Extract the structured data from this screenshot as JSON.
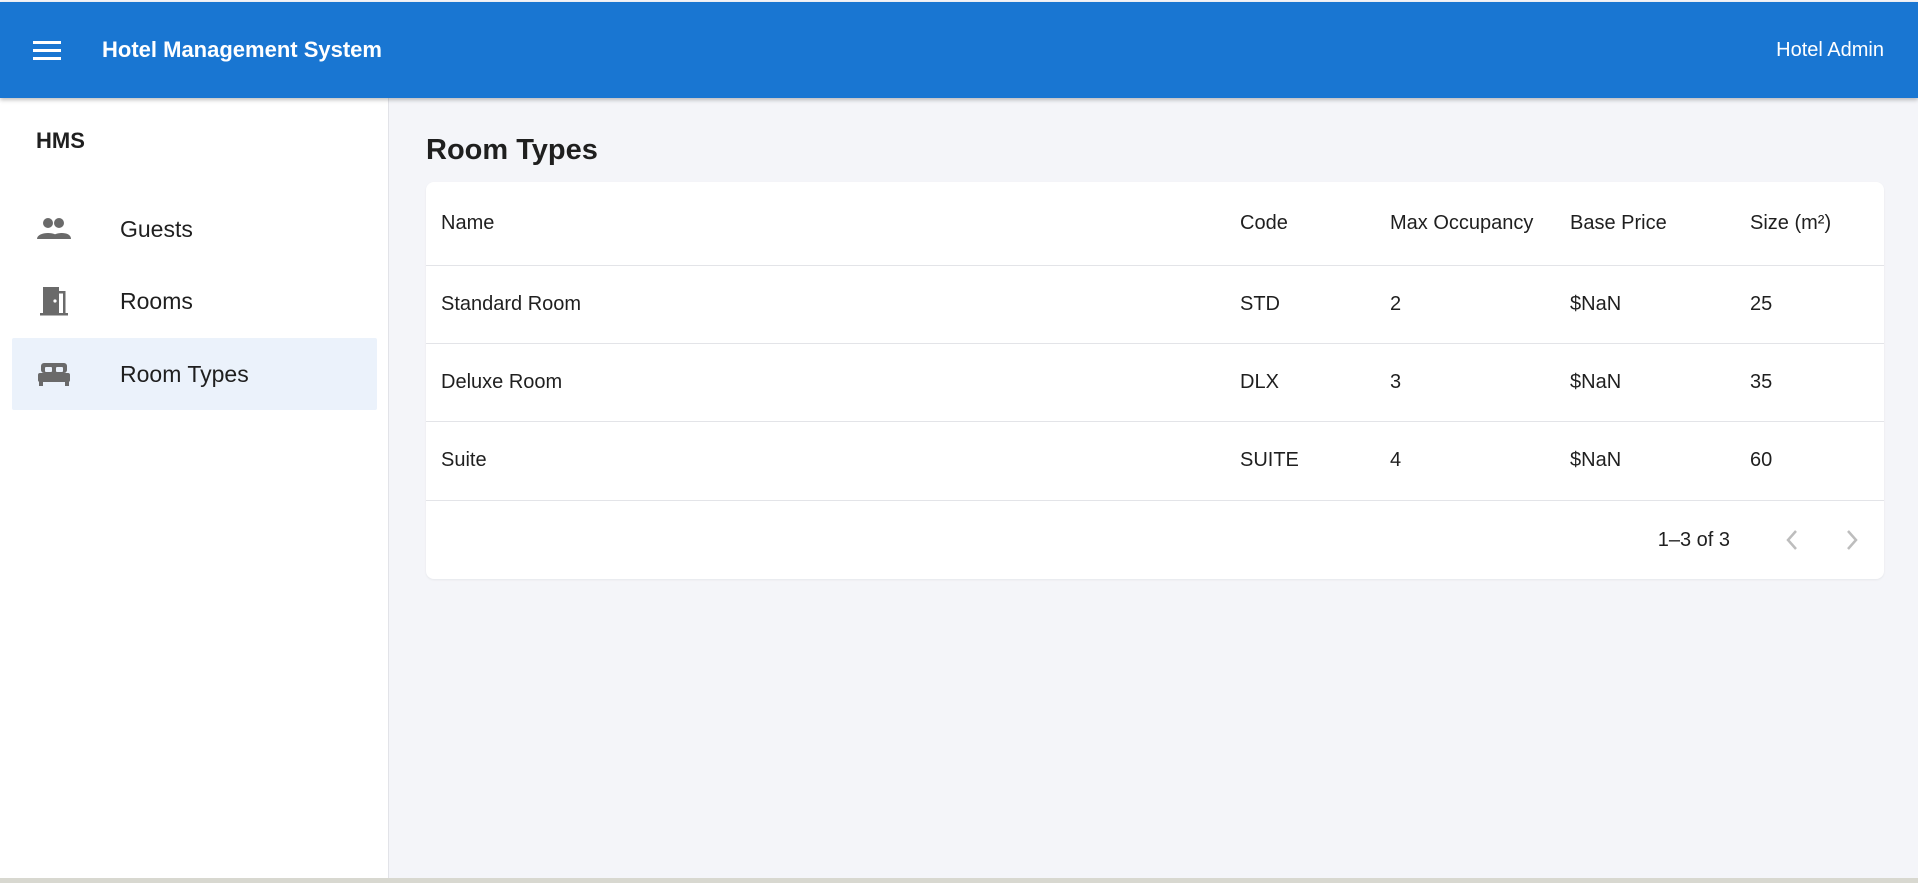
{
  "header": {
    "title": "Hotel Management System",
    "user": "Hotel Admin",
    "color": "#1976d2"
  },
  "sidebar": {
    "brand": "HMS",
    "items": [
      {
        "label": "Guests",
        "icon": "people-icon",
        "active": false
      },
      {
        "label": "Rooms",
        "icon": "door-icon",
        "active": false
      },
      {
        "label": "Room Types",
        "icon": "bed-icon",
        "active": true
      }
    ]
  },
  "main": {
    "title": "Room Types",
    "table": {
      "columns": [
        "Name",
        "Code",
        "Max Occupancy",
        "Base Price",
        "Size (m²)"
      ],
      "rows": [
        [
          "Standard Room",
          "STD",
          "2",
          "$NaN",
          "25"
        ],
        [
          "Deluxe Room",
          "DLX",
          "3",
          "$NaN",
          "35"
        ],
        [
          "Suite",
          "SUITE",
          "4",
          "$NaN",
          "60"
        ]
      ]
    },
    "pagination": {
      "text": "1–3 of 3",
      "prev_icon": "chevron-left-icon",
      "next_icon": "chevron-right-icon"
    }
  }
}
